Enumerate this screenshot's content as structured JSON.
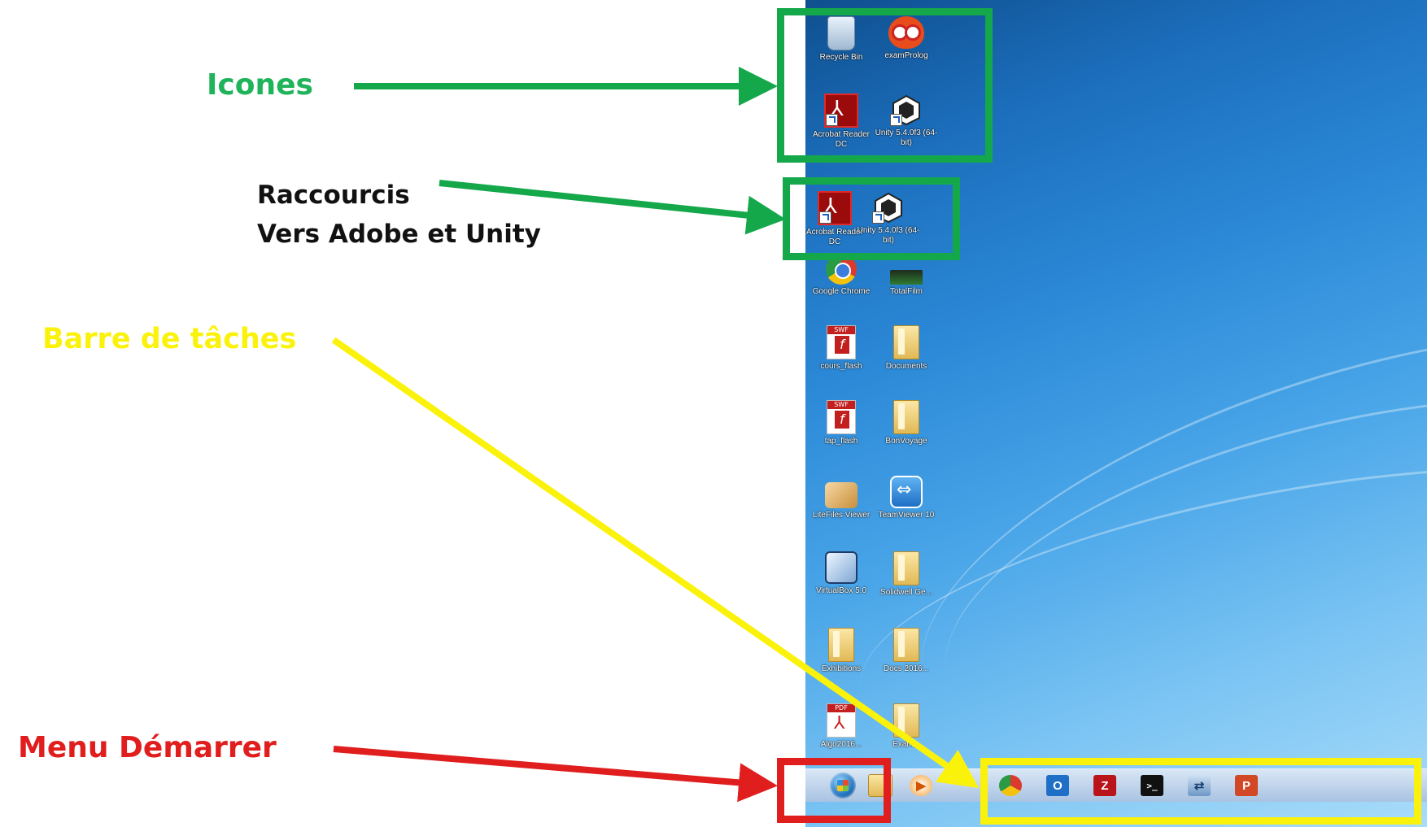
{
  "annotations": {
    "icones": "Icones",
    "raccourcis_line1": "Raccourcis",
    "raccourcis_line2": "Vers Adobe et Unity",
    "barre": "Barre de tâches",
    "menu": "Menu Démarrer"
  },
  "colors": {
    "green": "#14a84b",
    "yellow": "#fbf20c",
    "red": "#e01e1e"
  },
  "desktop": {
    "icons": [
      {
        "label": "Recycle Bin",
        "icon": "recycle-bin-icon"
      },
      {
        "label": "examProlog",
        "icon": "owl-icon"
      },
      {
        "label": "Acrobat Reader DC",
        "icon": "acrobat-icon"
      },
      {
        "label": "Unity 5.4.0f3 (64-bit)",
        "icon": "unity-icon"
      },
      {
        "label": "Acrobat Reader DC",
        "icon": "acrobat-icon"
      },
      {
        "label": "Unity 5.4.0f3 (64-bit)",
        "icon": "unity-icon"
      },
      {
        "label": "Google Chrome",
        "icon": "chrome-icon"
      },
      {
        "label": "TotalFilm",
        "icon": "green-bar-icon"
      },
      {
        "label": "cours_flash",
        "icon": "flash-file-icon"
      },
      {
        "label": "Documents",
        "icon": "folder-icon"
      },
      {
        "label": "tap_flash",
        "icon": "flash-file-icon"
      },
      {
        "label": "BonVoyage",
        "icon": "folder-icon"
      },
      {
        "label": "LiteFiles Viewer",
        "icon": "papers-icon"
      },
      {
        "label": "TeamViewer 10",
        "icon": "teamviewer-icon"
      },
      {
        "label": "VirtualBox 5.0",
        "icon": "cube-icon"
      },
      {
        "label": "Solidwell Ge...",
        "icon": "folder-icon"
      },
      {
        "label": "Exhibitions",
        "icon": "folder-icon"
      },
      {
        "label": "Docs 2016...",
        "icon": "folder-icon"
      },
      {
        "label": "Algo2016...",
        "icon": "pdf-file-icon"
      },
      {
        "label": "Exam...",
        "icon": "folder-icon"
      }
    ]
  },
  "taskbar": {
    "items": [
      {
        "name": "start-button",
        "icon": "windows-orb-icon"
      },
      {
        "name": "explorer-button",
        "icon": "folder-icon",
        "glyph": ""
      },
      {
        "name": "media-player-button",
        "icon": "media-player-icon",
        "glyph": "▶"
      },
      {
        "name": "chrome-button",
        "icon": "chrome-icon",
        "glyph": ""
      },
      {
        "name": "outlook-button",
        "icon": "outlook-icon",
        "glyph": "O"
      },
      {
        "name": "filezilla-button",
        "icon": "filezilla-icon",
        "glyph": "Z"
      },
      {
        "name": "cmd-button",
        "icon": "terminal-icon",
        "glyph": ">_"
      },
      {
        "name": "network-button",
        "icon": "network-icon",
        "glyph": "⇄"
      },
      {
        "name": "powerpoint-button",
        "icon": "powerpoint-icon",
        "glyph": "P"
      }
    ]
  }
}
